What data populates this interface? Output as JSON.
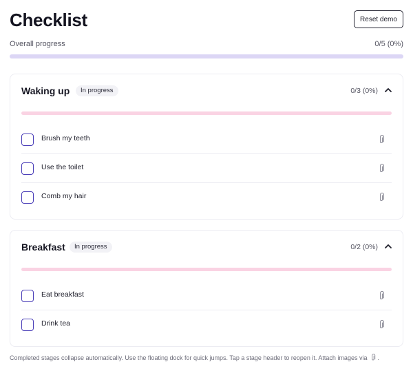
{
  "header": {
    "title": "Checklist",
    "reset_label": "Reset demo"
  },
  "overall": {
    "label": "Overall progress",
    "count": "0/5 (0%)",
    "progress": 0
  },
  "stages": [
    {
      "title": "Waking up",
      "badge": "In progress",
      "count": "0/3 (0%)",
      "progress": 0,
      "expanded": true,
      "tasks": [
        {
          "label": "Brush my teeth",
          "checked": false
        },
        {
          "label": "Use the toilet",
          "checked": false
        },
        {
          "label": "Comb my hair",
          "checked": false
        }
      ]
    },
    {
      "title": "Breakfast",
      "badge": "In progress",
      "count": "0/2 (0%)",
      "progress": 0,
      "expanded": true,
      "tasks": [
        {
          "label": "Eat breakfast",
          "checked": false
        },
        {
          "label": "Drink tea",
          "checked": false
        }
      ]
    }
  ],
  "footer": {
    "text": "Completed stages collapse automatically. Use the floating dock for quick jumps. Tap a stage header to reopen it. Attach images via",
    "suffix": "."
  },
  "icons": {
    "expand": "chevron-up-icon",
    "attach": "paperclip-icon"
  },
  "colors": {
    "accent": "#4b3fb8",
    "overall_track": "#dcd6f5",
    "stage_track": "#fad3e3"
  }
}
